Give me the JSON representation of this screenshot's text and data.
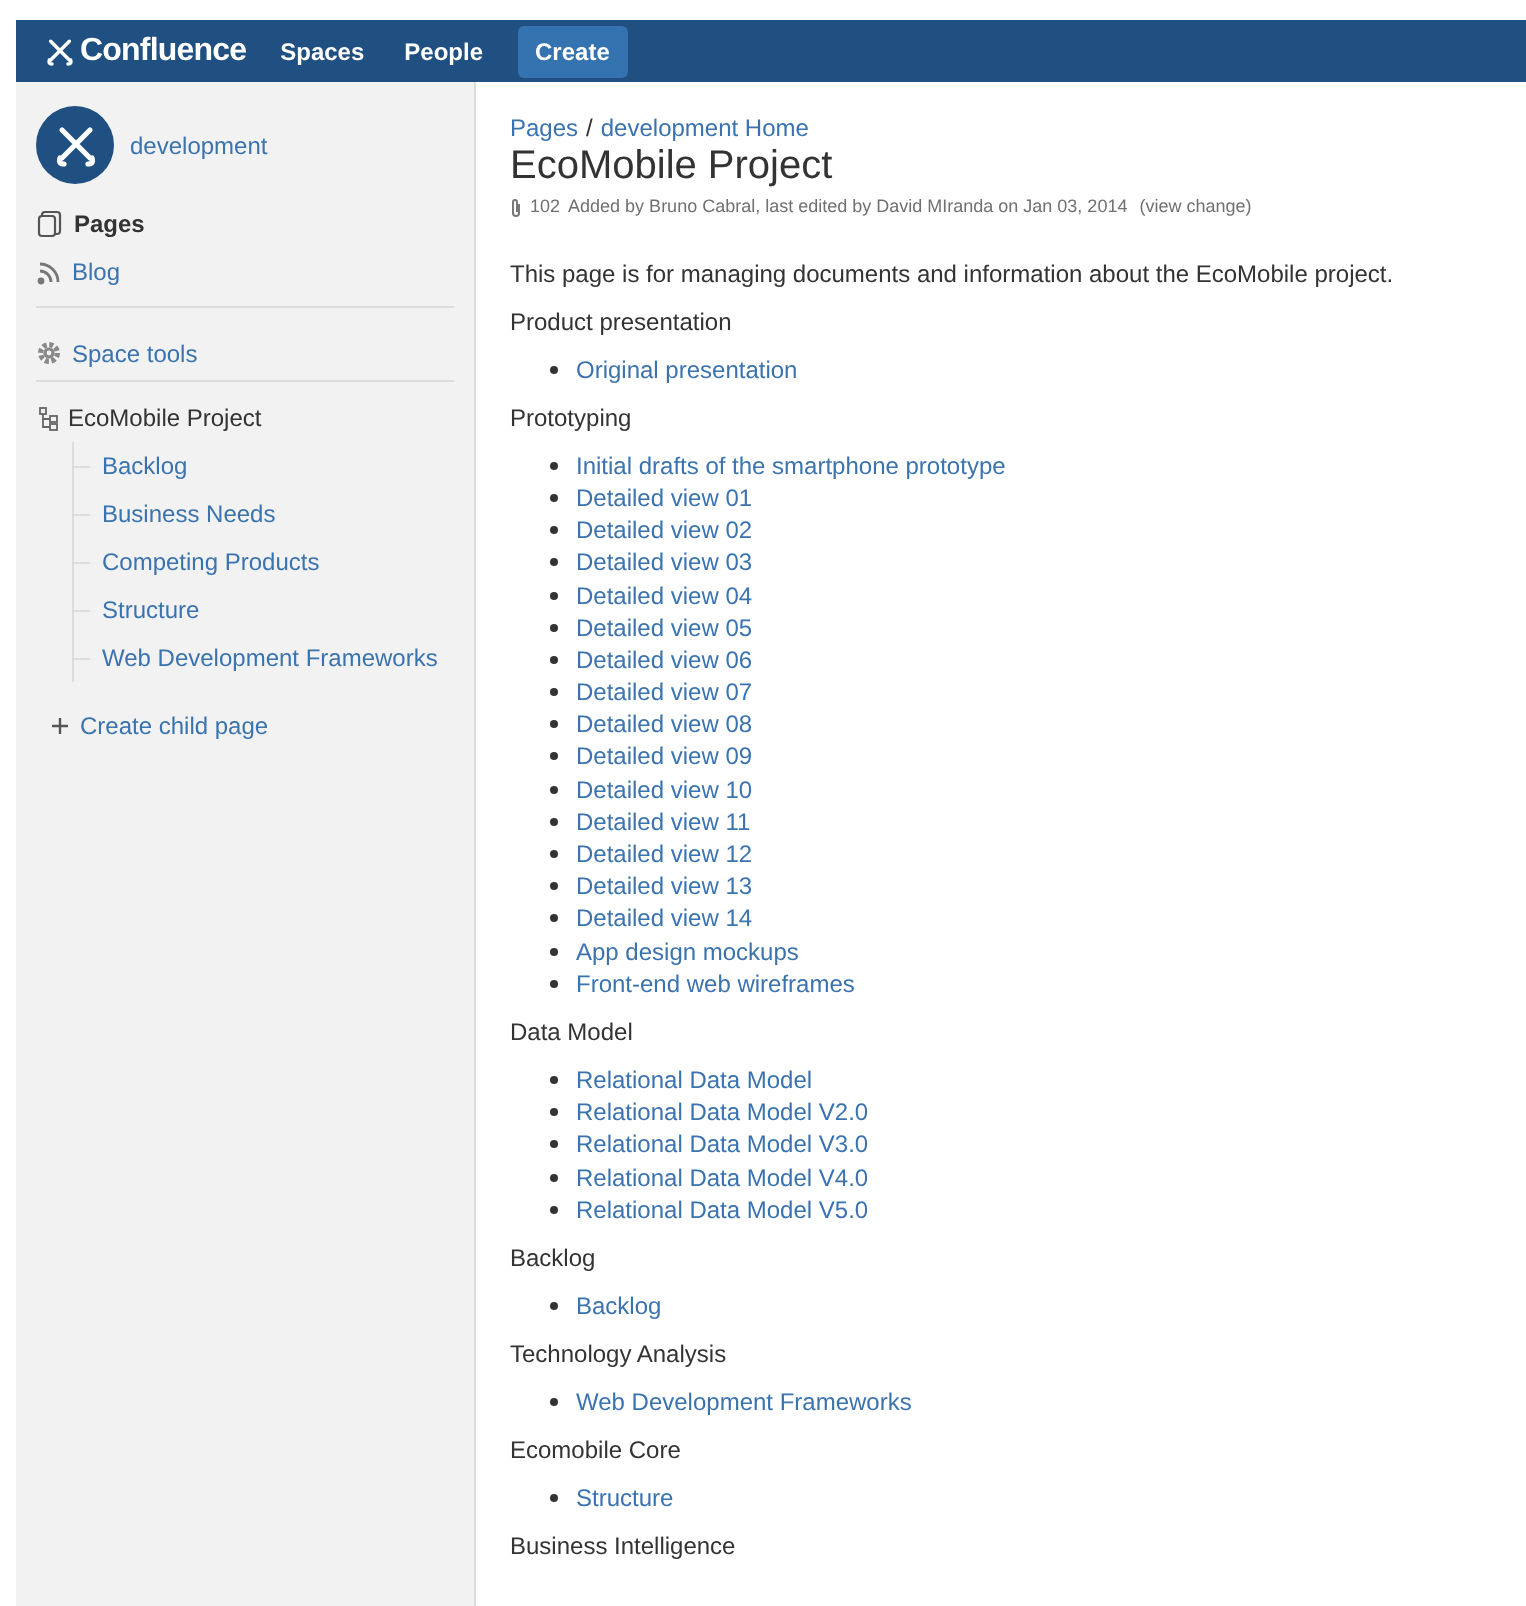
{
  "header": {
    "logo": "Confluence",
    "nav": [
      "Spaces",
      "People"
    ],
    "create_button": "Create"
  },
  "sidebar": {
    "space_name": "development",
    "nav": [
      {
        "label": "Pages",
        "selected": true,
        "kind": "pages"
      },
      {
        "label": "Blog",
        "selected": false,
        "kind": "blog"
      }
    ],
    "space_tools": "Space tools",
    "tree": {
      "label": "EcoMobile Project",
      "children": [
        "Backlog",
        "Business Needs",
        "Competing Products",
        "Structure",
        "Web Development Frameworks"
      ]
    },
    "create_child": "Create child page"
  },
  "page": {
    "breadcrumbs": [
      "Pages",
      "development Home"
    ],
    "breadcrumb_separator": "/",
    "title": "EcoMobile Project",
    "attachments": "102",
    "byline": "Added by Bruno Cabral, last edited by David MIranda on Jan 03, 2014",
    "view_change": "(view change)",
    "intro": "This page is for managing documents and information about the EcoMobile project.",
    "sections": [
      {
        "heading": "Product presentation",
        "links": [
          "Original presentation"
        ]
      },
      {
        "heading": "Prototyping",
        "links": [
          "Initial drafts of the smartphone prototype",
          "Detailed view 01",
          "Detailed view 02",
          "Detailed view 03",
          "Detailed view 04",
          "Detailed view 05",
          "Detailed view 06",
          "Detailed view 07",
          "Detailed view 08",
          "Detailed view 09",
          "Detailed view 10",
          "Detailed view 11",
          "Detailed view 12",
          "Detailed view 13",
          "Detailed view 14",
          "App design mockups",
          "Front-end web wireframes"
        ]
      },
      {
        "heading": "Data Model",
        "links": [
          "Relational Data Model",
          "Relational Data Model V2.0",
          "Relational Data Model V3.0",
          "Relational Data Model V4.0",
          "Relational Data Model V5.0"
        ]
      },
      {
        "heading": "Backlog",
        "links": [
          "Backlog"
        ]
      },
      {
        "heading": "Technology Analysis",
        "links": [
          "Web Development Frameworks"
        ]
      },
      {
        "heading": "Ecomobile Core",
        "links": [
          "Structure"
        ]
      },
      {
        "heading": "Business Intelligence"
      }
    ]
  }
}
